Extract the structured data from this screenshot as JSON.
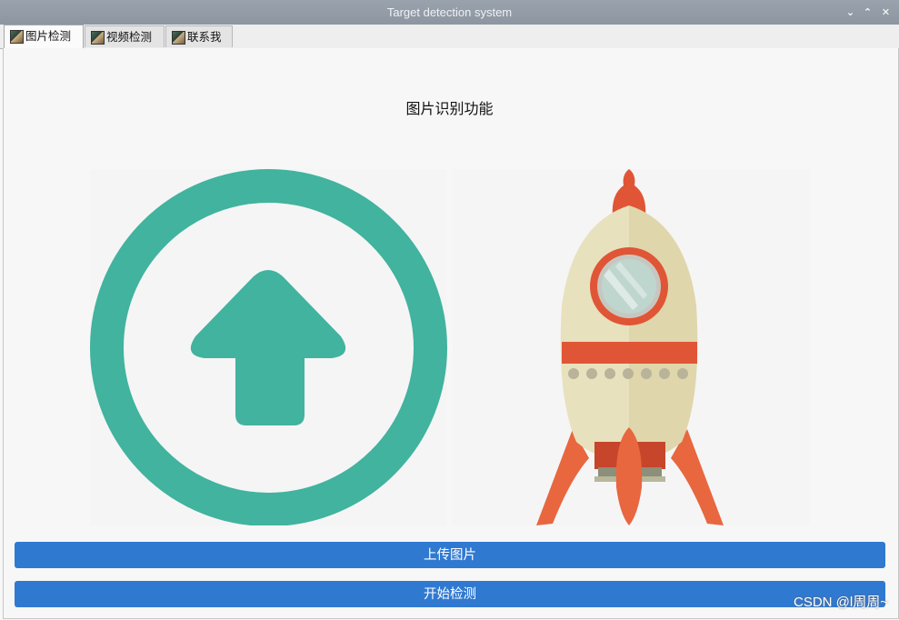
{
  "window": {
    "title": "Target detection system",
    "controls": {
      "minimize": "⌄",
      "maximize": "⌃",
      "close": "✕"
    }
  },
  "tabs": [
    {
      "label": "图片检测",
      "active": true
    },
    {
      "label": "视频检测",
      "active": false
    },
    {
      "label": "联系我",
      "active": false
    }
  ],
  "main": {
    "title": "图片识别功能",
    "left_image": "upload-icon",
    "right_image": "rocket-illustration",
    "buttons": {
      "upload_label": "上传图片",
      "detect_label": "开始检测"
    }
  },
  "watermark": "CSDN @l周周~",
  "colors": {
    "accent": "#3079d1",
    "upload_icon": "#41b39e",
    "rocket_red": "#e05536",
    "rocket_cream": "#e8e1bd"
  }
}
